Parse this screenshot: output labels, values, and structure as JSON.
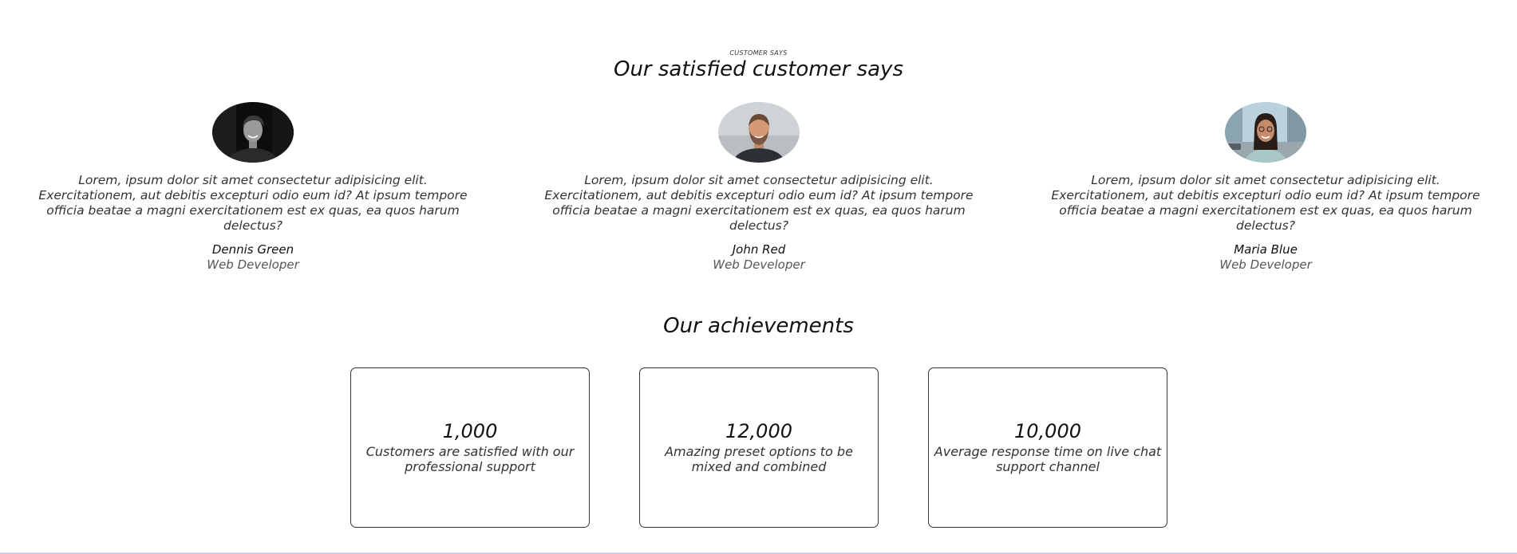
{
  "customers": {
    "eyebrow": "CUSTOMER SAYS",
    "title": "Our satisfied customer says",
    "testimonials": [
      {
        "quote": "Lorem, ipsum dolor sit amet consectetur adipisicing elit. Exercitationem, aut debitis excepturi odio eum id? At ipsum tempore officia beatae a magni exercitationem est ex quas, ea quos harum delectus?",
        "name": "Dennis Green",
        "role": "Web Developer",
        "avatar_icon": "person-photo-bw"
      },
      {
        "quote": "Lorem, ipsum dolor sit amet consectetur adipisicing elit. Exercitationem, aut debitis excepturi odio eum id? At ipsum tempore officia beatae a magni exercitationem est ex quas, ea quos harum delectus?",
        "name": "John Red",
        "role": "Web Developer",
        "avatar_icon": "person-photo-bearded"
      },
      {
        "quote": "Lorem, ipsum dolor sit amet consectetur adipisicing elit. Exercitationem, aut debitis excepturi odio eum id? At ipsum tempore officia beatae a magni exercitationem est ex quas, ea quos harum delectus?",
        "name": "Maria Blue",
        "role": "Web Developer",
        "avatar_icon": "person-photo-street"
      }
    ]
  },
  "achievements": {
    "title": "Our achievements",
    "cards": [
      {
        "value": "1,000",
        "description": "Customers are satisfied with our professional support"
      },
      {
        "value": "12,000",
        "description": "Amazing preset options to be mixed and combined"
      },
      {
        "value": "10,000",
        "description": "Average response time on live chat support channel"
      }
    ]
  },
  "colors": {
    "text": "#222222",
    "card_border": "#333333",
    "bottom_line": "#d6d0e6"
  }
}
